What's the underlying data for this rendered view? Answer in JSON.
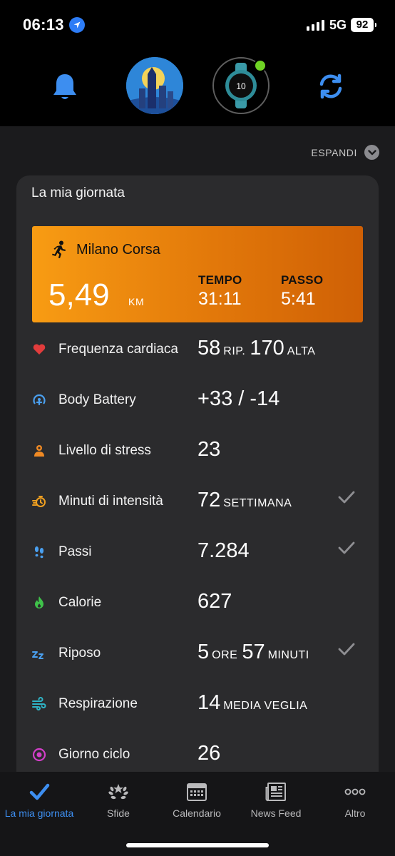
{
  "status_bar": {
    "time": "06:13",
    "network": "5G",
    "battery": "92"
  },
  "header": {
    "icons": [
      "bell-icon",
      "profile-avatar",
      "device-watch",
      "sync-icon"
    ],
    "watch_face_text": "10"
  },
  "expand": {
    "label": "ESPANDI"
  },
  "card": {
    "title": "La mia giornata",
    "activity": {
      "name": "Milano Corsa",
      "distance": "5,49",
      "distance_unit": "KM",
      "time_label": "TEMPO",
      "time_value": "31:11",
      "pace_label": "PASSO",
      "pace_value": "5:41",
      "gradient": [
        "#f89c13",
        "#cf6005"
      ]
    },
    "metrics": [
      {
        "label": "Frequenza cardiaca",
        "v1": "58",
        "u1": "RIP.",
        "v2": "170",
        "u2": "ALTA",
        "icon": "heart-icon",
        "color": "#e23c3c",
        "checked": false
      },
      {
        "label": "Body Battery",
        "v1": "+33 / -14",
        "u1": "",
        "v2": "",
        "u2": "",
        "icon": "body-battery-icon",
        "color": "#4aa0f0",
        "checked": false
      },
      {
        "label": "Livello di stress",
        "v1": "23",
        "u1": "",
        "v2": "",
        "u2": "",
        "icon": "stress-icon",
        "color": "#f08a24",
        "checked": false
      },
      {
        "label": "Minuti di intensità",
        "v1": "72",
        "u1": "SETTIMANA",
        "v2": "",
        "u2": "",
        "icon": "intensity-icon",
        "color": "#f0a020",
        "checked": true
      },
      {
        "label": "Passi",
        "v1": "7.284",
        "u1": "",
        "v2": "",
        "u2": "",
        "icon": "steps-icon",
        "color": "#4aa0f0",
        "checked": true
      },
      {
        "label": "Calorie",
        "v1": "627",
        "u1": "",
        "v2": "",
        "u2": "",
        "icon": "flame-icon",
        "color": "#3fc24a",
        "checked": false
      },
      {
        "label": "Riposo",
        "v1": "5",
        "u1": "ORE",
        "v2": "57",
        "u2": "MINUTI",
        "icon": "sleep-icon",
        "color": "#4aa0f0",
        "checked": true
      },
      {
        "label": "Respirazione",
        "v1": "14",
        "u1": "MEDIA VEGLIA",
        "v2": "",
        "u2": "",
        "icon": "respiration-icon",
        "color": "#2fb6c8",
        "checked": false
      },
      {
        "label": "Giorno ciclo",
        "v1": "26",
        "u1": "",
        "v2": "",
        "u2": "",
        "icon": "cycle-icon",
        "color": "#d23fc8",
        "checked": false
      }
    ]
  },
  "tabbar": {
    "tabs": [
      {
        "label": "La mia giornata",
        "icon": "checkmark-icon",
        "active": true
      },
      {
        "label": "Sfide",
        "icon": "laurel-icon",
        "active": false
      },
      {
        "label": "Calendario",
        "icon": "calendar-icon",
        "active": false
      },
      {
        "label": "News Feed",
        "icon": "newspaper-icon",
        "active": false
      },
      {
        "label": "Altro",
        "icon": "more-icon",
        "active": false
      }
    ],
    "active_color": "#3d8ef0"
  }
}
